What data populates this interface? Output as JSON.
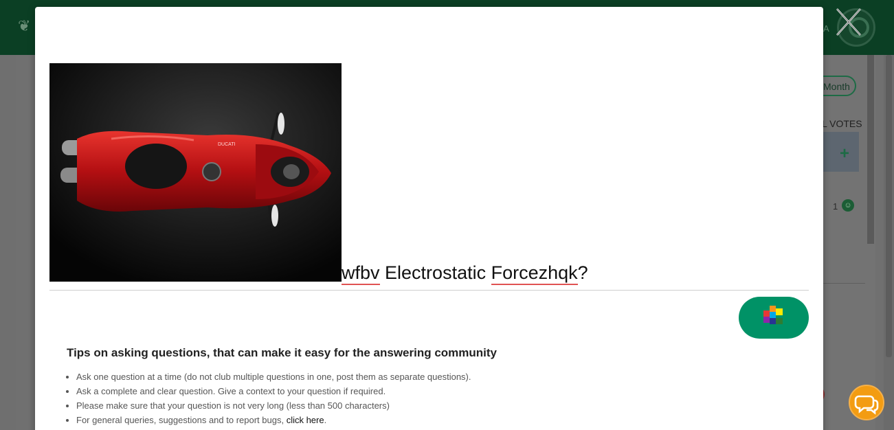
{
  "background": {
    "header_text": "A",
    "month_button": "Month",
    "votes_label": "L VOTES",
    "vote_count": "1"
  },
  "modal": {
    "question": {
      "title_prefix": "wfbv",
      "title_middle": " Electrostatic ",
      "title_suffix": "Forcezhqk",
      "title_end": "?"
    },
    "tips": {
      "heading": "Tips on asking questions, that can make it easy for the answering community",
      "items": [
        "Ask one question at a time (do not club multiple questions in one, post them as separate questions).",
        "Ask a complete and clear question. Give a context to your question if required.",
        "Please make sure that your question is not very long (less than 500 characters)"
      ],
      "last_item_prefix": "For general queries, suggestions and to report bugs, ",
      "last_item_link": "click here",
      "last_item_suffix": "."
    }
  },
  "colors": {
    "brand_green": "#009266",
    "header_dark": "#0b3f24",
    "chat_orange": "#f39c12",
    "misspell_red": "#e05252"
  },
  "icons": {
    "close": "close-icon",
    "apps": "apps-grid-icon",
    "chat": "chat-icon"
  }
}
